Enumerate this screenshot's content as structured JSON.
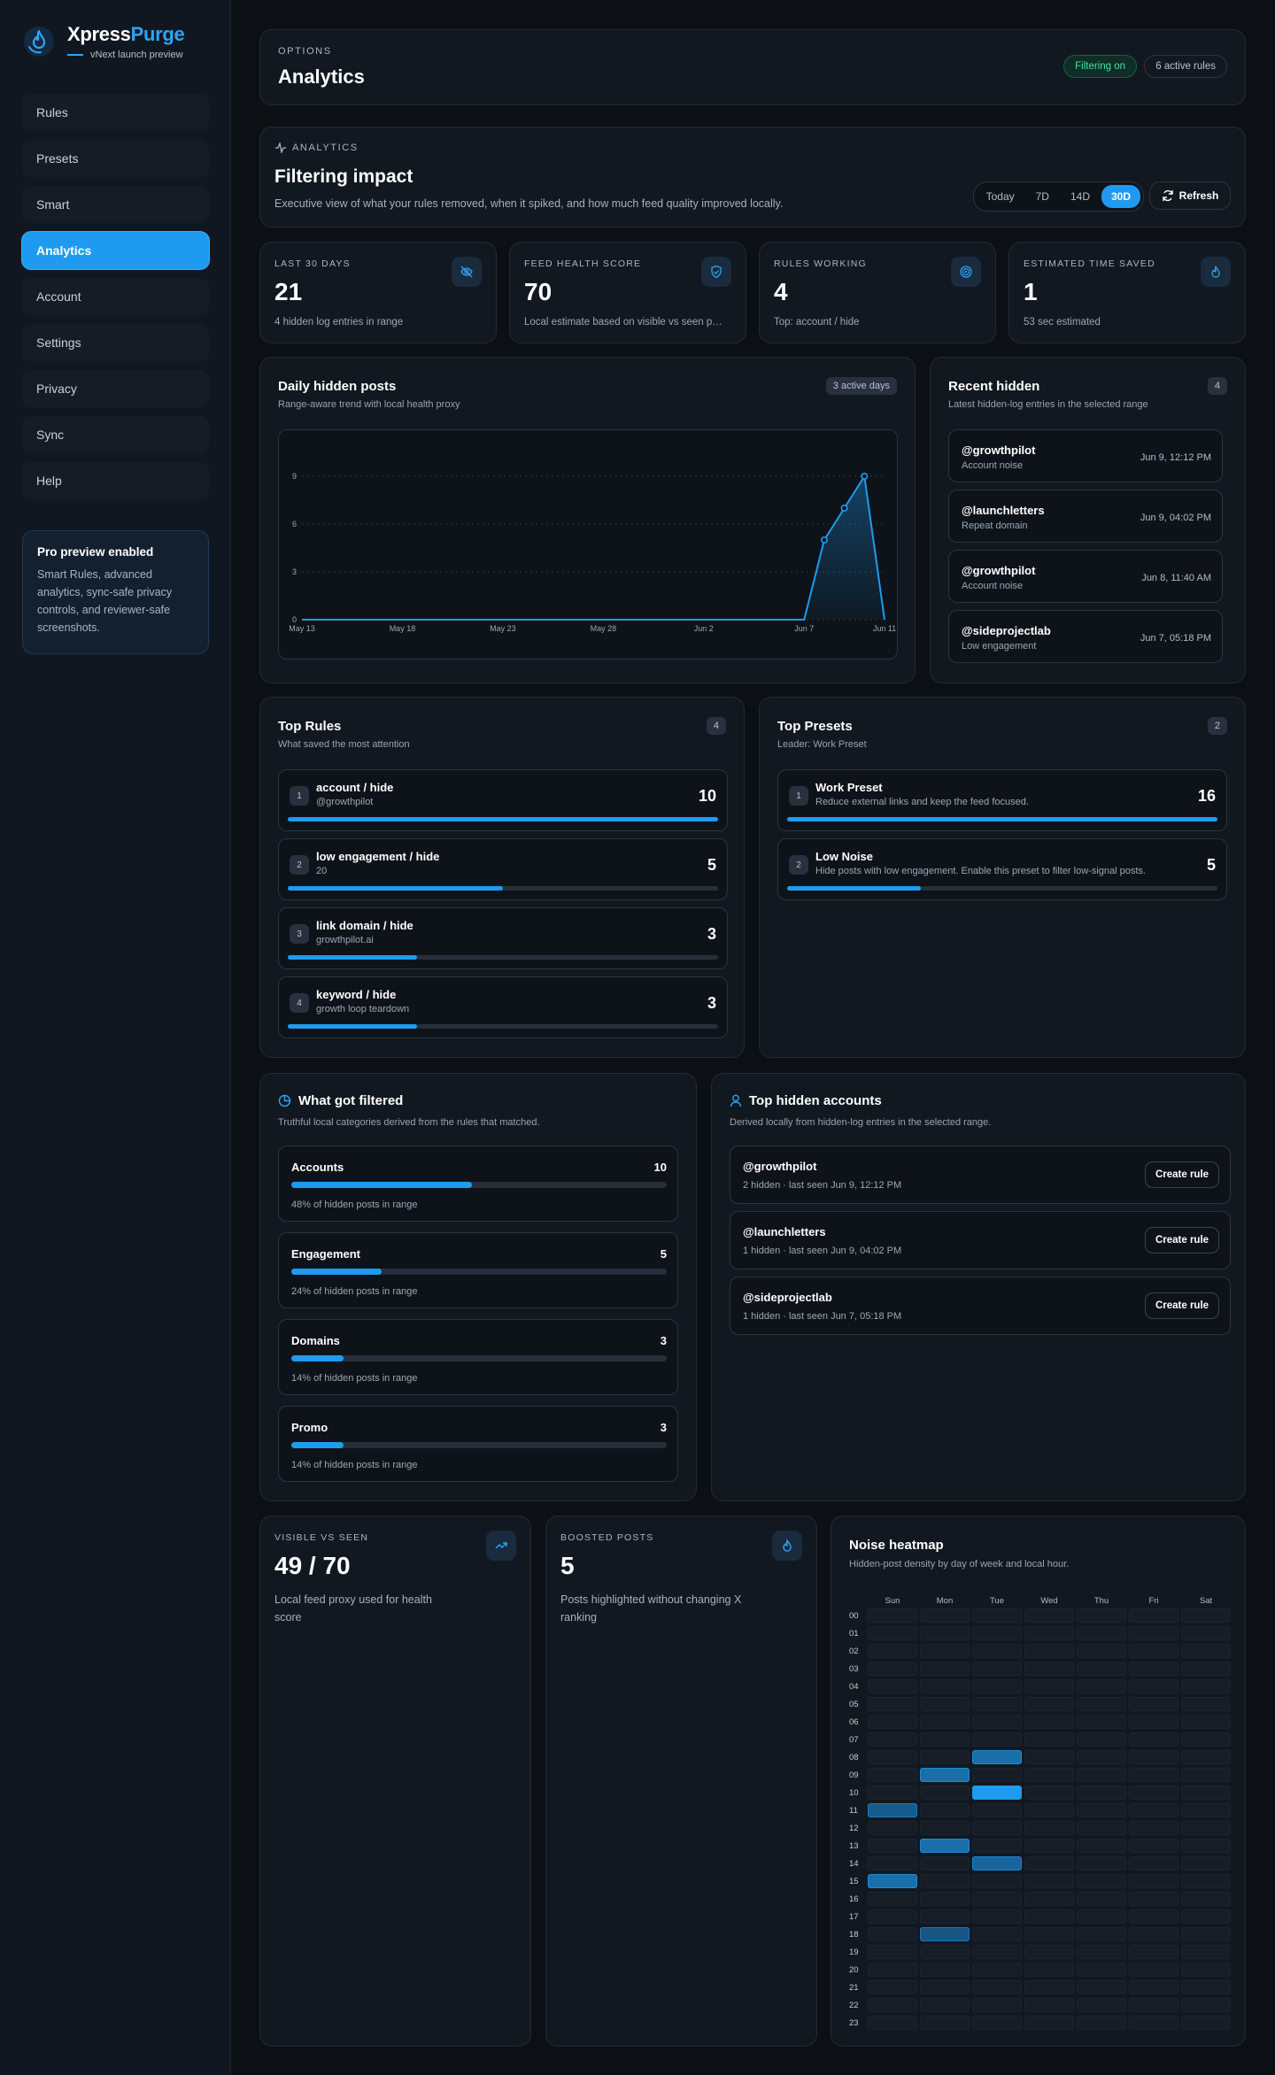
{
  "brand": {
    "name_a": "Xpress",
    "name_b": "Purge",
    "subtitle": "vNext launch preview"
  },
  "nav": [
    "Rules",
    "Presets",
    "Smart",
    "Analytics",
    "Account",
    "Settings",
    "Privacy",
    "Sync",
    "Help"
  ],
  "nav_active": "Analytics",
  "pro": {
    "title": "Pro preview enabled",
    "text": "Smart Rules, advanced analytics, sync-safe privacy controls, and reviewer-safe screenshots."
  },
  "header": {
    "eyebrow": "Options",
    "title": "Analytics",
    "status": "Filtering on",
    "rules": "6 active rules"
  },
  "impact": {
    "eyebrow": "Analytics",
    "title": "Filtering impact",
    "desc": "Executive view of what your rules removed, when it spiked, and how much feed quality improved locally.",
    "ranges": [
      "Today",
      "7D",
      "14D",
      "30D"
    ],
    "active_range": "30D",
    "refresh": "Refresh"
  },
  "stats": [
    {
      "label": "Last 30 days",
      "value": "21",
      "desc": "4 hidden log entries in range",
      "icon": "eye-off-icon"
    },
    {
      "label": "Feed health score",
      "value": "70",
      "desc": "Local estimate based on visible vs seen posts",
      "icon": "shield-icon"
    },
    {
      "label": "Rules working",
      "value": "4",
      "desc": "Top: account / hide",
      "icon": "target-icon"
    },
    {
      "label": "Estimated time saved",
      "value": "1",
      "desc": "53 sec estimated",
      "icon": "timer-icon"
    }
  ],
  "daily": {
    "title": "Daily hidden posts",
    "sub": "Range-aware trend with local health proxy",
    "badge": "3 active days"
  },
  "chart_data": {
    "type": "area",
    "x": [
      "May 13",
      "May 14",
      "May 15",
      "May 16",
      "May 17",
      "May 18",
      "May 19",
      "May 20",
      "May 21",
      "May 22",
      "May 23",
      "May 24",
      "May 25",
      "May 26",
      "May 27",
      "May 28",
      "May 29",
      "May 30",
      "May 31",
      "Jun 1",
      "Jun 2",
      "Jun 3",
      "Jun 4",
      "Jun 5",
      "Jun 6",
      "Jun 7",
      "Jun 8",
      "Jun 9",
      "Jun 10",
      "Jun 11"
    ],
    "values": [
      0,
      0,
      0,
      0,
      0,
      0,
      0,
      0,
      0,
      0,
      0,
      0,
      0,
      0,
      0,
      0,
      0,
      0,
      0,
      0,
      0,
      0,
      0,
      0,
      0,
      0,
      5,
      7,
      9,
      0
    ],
    "tick_labels": [
      "May 13",
      "May 18",
      "May 23",
      "May 28",
      "Jun 2",
      "Jun 7",
      "Jun 11"
    ],
    "yticks": [
      0,
      3,
      6,
      9
    ],
    "ylim": [
      0,
      10
    ]
  },
  "recent": {
    "title": "Recent hidden",
    "sub": "Latest hidden-log entries in the selected range",
    "count": "4",
    "items": [
      {
        "name": "@growthpilot",
        "reason": "Account noise",
        "time": "Jun 9, 12:12 PM"
      },
      {
        "name": "@launchletters",
        "reason": "Repeat domain",
        "time": "Jun 9, 04:02 PM"
      },
      {
        "name": "@growthpilot",
        "reason": "Account noise",
        "time": "Jun 8, 11:40 AM"
      },
      {
        "name": "@sideprojectlab",
        "reason": "Low engagement",
        "time": "Jun 7, 05:18 PM"
      }
    ]
  },
  "top_rules": {
    "title": "Top Rules",
    "sub": "What saved the most attention",
    "count": "4",
    "items": [
      {
        "rank": "1",
        "name": "account / hide",
        "detail": "@growthpilot",
        "value": "10",
        "pct": 100
      },
      {
        "rank": "2",
        "name": "low engagement / hide",
        "detail": "20",
        "value": "5",
        "pct": 50
      },
      {
        "rank": "3",
        "name": "link domain / hide",
        "detail": "growthpilot.ai",
        "value": "3",
        "pct": 30
      },
      {
        "rank": "4",
        "name": "keyword / hide",
        "detail": "growth loop teardown",
        "value": "3",
        "pct": 30
      }
    ]
  },
  "top_presets": {
    "title": "Top Presets",
    "sub": "Leader: Work Preset",
    "count": "2",
    "items": [
      {
        "rank": "1",
        "name": "Work Preset",
        "detail": "Reduce external links and keep the feed focused.",
        "value": "16",
        "pct": 100
      },
      {
        "rank": "2",
        "name": "Low Noise",
        "detail": "Hide posts with low engagement. Enable this preset to filter low-signal posts.",
        "value": "5",
        "pct": 31
      }
    ]
  },
  "filtered": {
    "title": "What got filtered",
    "sub": "Truthful local categories derived from the rules that matched.",
    "items": [
      {
        "name": "Accounts",
        "value": "10",
        "pct": 48,
        "desc": "48% of hidden posts in range"
      },
      {
        "name": "Engagement",
        "value": "5",
        "pct": 24,
        "desc": "24% of hidden posts in range"
      },
      {
        "name": "Domains",
        "value": "3",
        "pct": 14,
        "desc": "14% of hidden posts in range"
      },
      {
        "name": "Promo",
        "value": "3",
        "pct": 14,
        "desc": "14% of hidden posts in range"
      }
    ]
  },
  "accounts": {
    "title": "Top hidden accounts",
    "sub": "Derived locally from hidden-log entries in the selected range.",
    "button": "Create rule",
    "items": [
      {
        "name": "@growthpilot",
        "detail": "2 hidden · last seen Jun 9, 12:12 PM"
      },
      {
        "name": "@launchletters",
        "detail": "1 hidden · last seen Jun 9, 04:02 PM"
      },
      {
        "name": "@sideprojectlab",
        "detail": "1 hidden · last seen Jun 7, 05:18 PM"
      }
    ]
  },
  "visible": {
    "label": "Visible vs seen",
    "value": "49 / 70",
    "desc": "Local feed proxy used for health score",
    "icon": "trend-up-icon"
  },
  "boosted": {
    "label": "Boosted posts",
    "value": "5",
    "desc": "Posts highlighted without changing X ranking",
    "icon": "flame-icon"
  },
  "heatmap": {
    "title": "Noise heatmap",
    "sub": "Hidden-post density by day of week and local hour.",
    "days": [
      "Sun",
      "Mon",
      "Tue",
      "Wed",
      "Thu",
      "Fri",
      "Sat"
    ],
    "hours": [
      "00",
      "01",
      "02",
      "03",
      "04",
      "05",
      "06",
      "07",
      "08",
      "09",
      "10",
      "11",
      "12",
      "13",
      "14",
      "15",
      "16",
      "17",
      "18",
      "19",
      "20",
      "21",
      "22",
      "23"
    ],
    "cells": [
      {
        "day": 2,
        "hour": 8,
        "level": 0.55
      },
      {
        "day": 1,
        "hour": 9,
        "level": 0.55
      },
      {
        "day": 2,
        "hour": 10,
        "level": 1.0
      },
      {
        "day": 0,
        "hour": 11,
        "level": 0.35
      },
      {
        "day": 1,
        "hour": 13,
        "level": 0.55
      },
      {
        "day": 2,
        "hour": 14,
        "level": 0.45
      },
      {
        "day": 0,
        "hour": 15,
        "level": 0.55
      },
      {
        "day": 1,
        "hour": 18,
        "level": 0.3
      }
    ]
  },
  "colors": {
    "accent": "#1e9bf0",
    "bg": "#0c0f14",
    "card": "#121820"
  }
}
